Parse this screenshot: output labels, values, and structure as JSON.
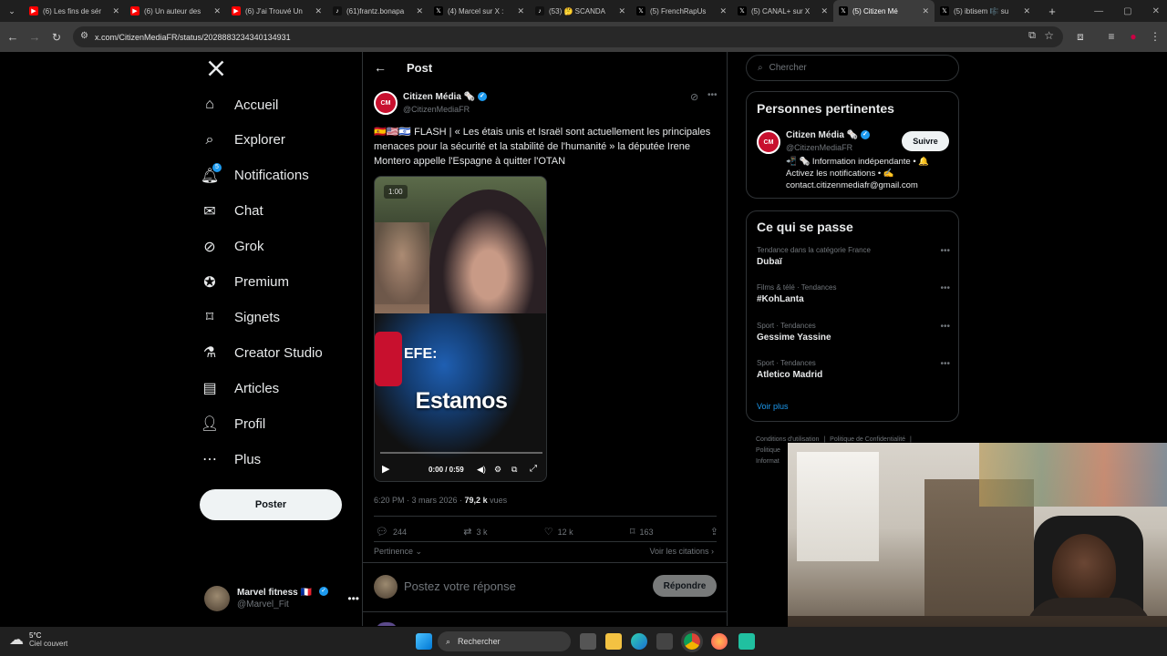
{
  "browser": {
    "tabs": [
      {
        "title": "(6) Les fins de sér",
        "favicon": "youtube-icon",
        "color": "#ff0000"
      },
      {
        "title": "(6) Un auteur des",
        "favicon": "youtube-icon",
        "color": "#ff0000"
      },
      {
        "title": "(6) J'ai Trouvé Un",
        "favicon": "youtube-icon",
        "color": "#ff0000"
      },
      {
        "title": "(61)frantz.bonapa",
        "favicon": "tiktok-icon",
        "color": "#111"
      },
      {
        "title": "(4) Marcel sur X :",
        "favicon": "x-icon",
        "color": "#000"
      },
      {
        "title": "(53) 🤔 SCANDA",
        "favicon": "tiktok-icon",
        "color": "#111"
      },
      {
        "title": "(5) FrenchRapUs",
        "favicon": "x-icon",
        "color": "#000"
      },
      {
        "title": "(5) CANAL+ sur X",
        "favicon": "x-icon",
        "color": "#000"
      },
      {
        "title": "(5) Citizen Mé",
        "favicon": "x-icon",
        "color": "#000"
      },
      {
        "title": "(5) ibtisem 🎼 su",
        "favicon": "x-icon",
        "color": "#000"
      }
    ],
    "url": "x.com/CitizenMediaFR/status/2028883234340134931"
  },
  "nav": {
    "items": [
      {
        "label": "Accueil",
        "icon": "home-icon"
      },
      {
        "label": "Explorer",
        "icon": "search-icon"
      },
      {
        "label": "Notifications",
        "icon": "bell-icon",
        "badge": "5"
      },
      {
        "label": "Chat",
        "icon": "mail-icon"
      },
      {
        "label": "Grok",
        "icon": "grok-icon"
      },
      {
        "label": "Premium",
        "icon": "premium-icon"
      },
      {
        "label": "Signets",
        "icon": "bookmark-icon"
      },
      {
        "label": "Creator Studio",
        "icon": "flask-icon"
      },
      {
        "label": "Articles",
        "icon": "article-icon"
      },
      {
        "label": "Profil",
        "icon": "person-icon"
      },
      {
        "label": "Plus",
        "icon": "more-circle-icon"
      }
    ],
    "post_button": "Poster",
    "account": {
      "name": "Marvel fitness 🇫🇷",
      "handle": "@Marvel_Fit"
    }
  },
  "post": {
    "header": "Post",
    "author_name": "Citizen Média 🗞️",
    "author_handle": "@CitizenMediaFR",
    "text": "🇪🇸🇺🇸🇮🇱 FLASH | « Les étais unis et Israël sont actuellement les principales menaces pour la sécurité et la stabilité de l'humanité » la députée Irene Montero appelle l'Espagne à quitter l'OTAN",
    "video": {
      "duration_badge": "1:00",
      "caption": "Estamos",
      "time": "0:00 / 0:59",
      "mic_text": "EFE:"
    },
    "time": "6:20 PM · 3 mars 2026 · ",
    "views": "79,2 k",
    "views_label": " vues",
    "replies": "244",
    "reposts": "3 k",
    "likes": "12 k",
    "bookmarks": "163",
    "sort": "Pertinence",
    "citations": "Voir les citations",
    "reply_placeholder": "Postez votre réponse",
    "reply_button": "Répondre"
  },
  "sidebar": {
    "search_placeholder": "Chercher",
    "relevant_title": "Personnes pertinentes",
    "person": {
      "name": "Citizen Média 🗞️",
      "handle": "@CitizenMediaFR",
      "follow": "Suivre",
      "bio": "📲 🗞️ Information indépendante • 🔔 Activez les notifications • ✍️ contact.citizenmediafr@gmail.com"
    },
    "trends_title": "Ce qui se passe",
    "trends": [
      {
        "meta": "Tendance dans la catégorie France",
        "name": "Dubaï"
      },
      {
        "meta": "Films & télé · Tendances",
        "name": "#KohLanta"
      },
      {
        "meta": "Sport · Tendances",
        "name": "Gessime Yassine"
      },
      {
        "meta": "Sport · Tendances",
        "name": "Atletico Madrid"
      }
    ],
    "show_more": "Voir plus",
    "footer": [
      "Conditions d'utilisation",
      "Politique de Confidentialité",
      "Politique",
      "Informat"
    ]
  },
  "taskbar": {
    "weather_temp": "5°C",
    "weather_desc": "Ciel couvert",
    "search": "Rechercher"
  }
}
